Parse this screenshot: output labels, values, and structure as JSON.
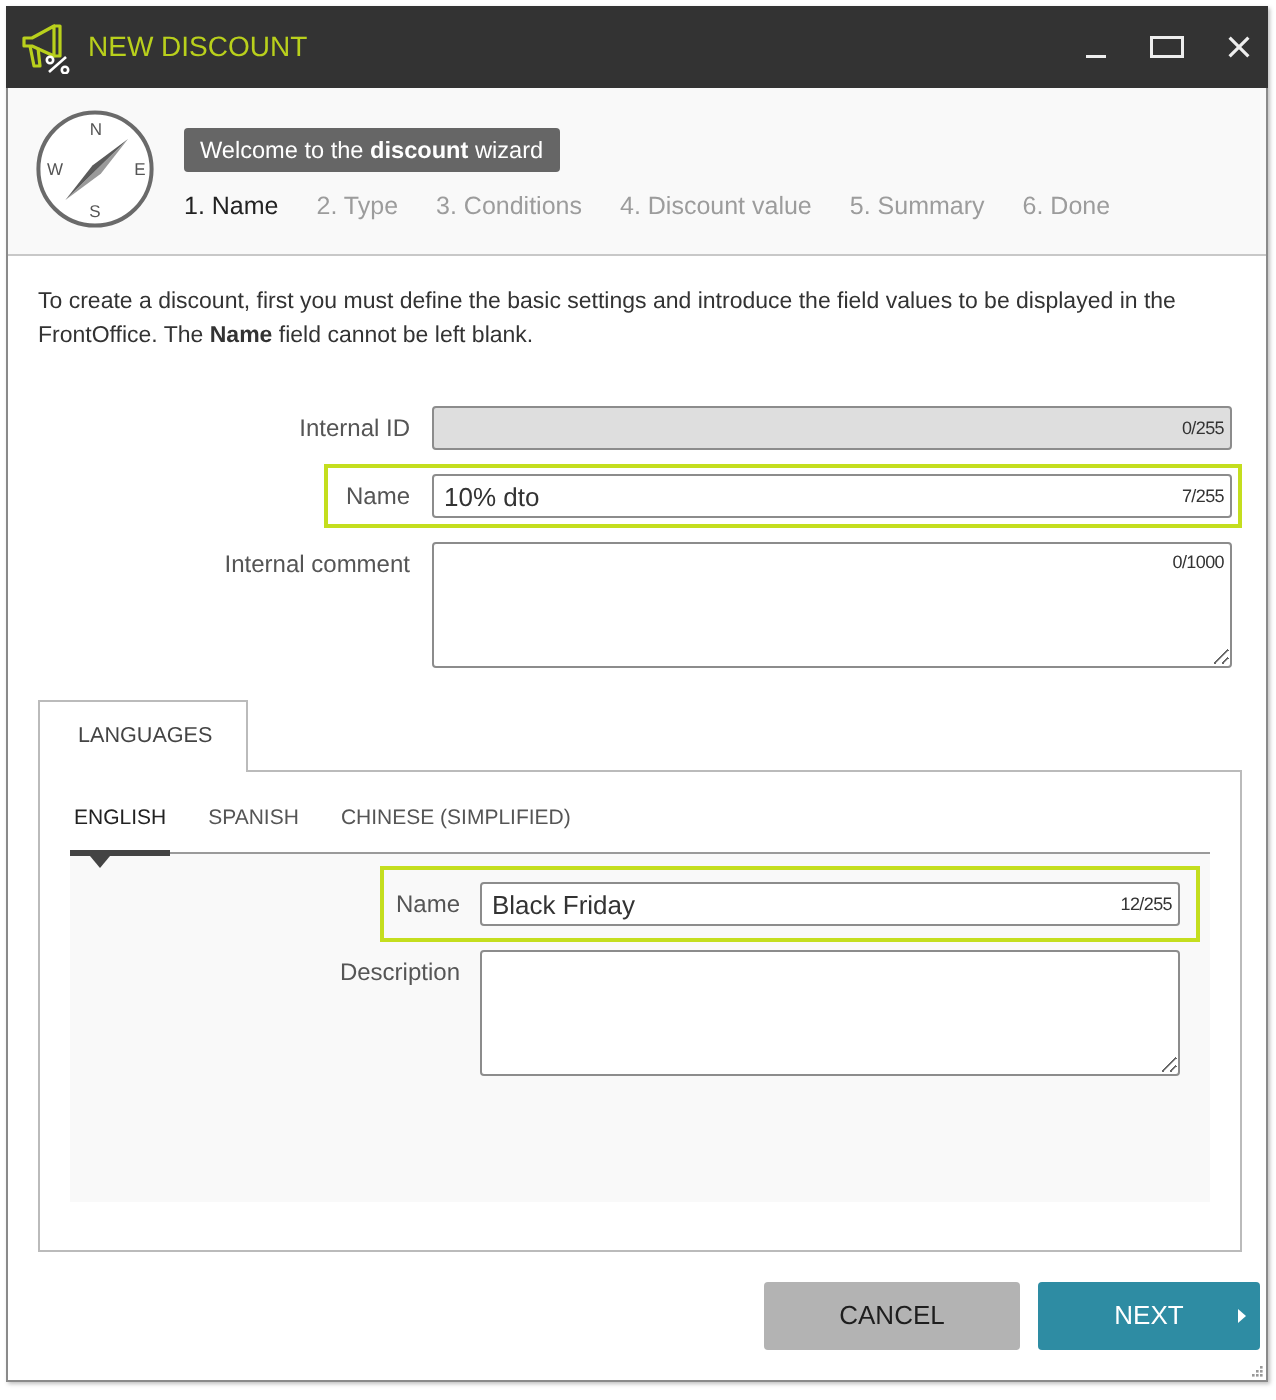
{
  "window": {
    "title": "NEW DISCOUNT"
  },
  "wizard": {
    "compass": {
      "north": "N",
      "west": "W",
      "east": "E",
      "south": "S"
    },
    "welcome": "Welcome to the **discount** wizard",
    "steps": [
      {
        "label": "1. Name",
        "selected": true
      },
      {
        "label": "2. Type",
        "selected": false
      },
      {
        "label": "3. Conditions",
        "selected": false
      },
      {
        "label": "4. Discount value",
        "selected": false
      },
      {
        "label": "5. Summary",
        "selected": false
      },
      {
        "label": "6. Done",
        "selected": false
      }
    ]
  },
  "intro": "To create a discount, first you must define the basic settings and introduce the field values to be displayed in the FrontOffice. The **Name** field cannot be left blank.",
  "fields": [
    {
      "label": "Internal ID",
      "kind": "input",
      "counter": "0/255",
      "disabled": true,
      "highlighted": false
    },
    {
      "label": "Name",
      "kind": "input",
      "value": "10% dto",
      "counter": "7/255",
      "disabled": false,
      "highlighted": true
    },
    {
      "label": "Internal comment",
      "kind": "textarea",
      "counter": "0/1000",
      "disabled": false,
      "highlighted": false
    }
  ],
  "section_tabs": [
    {
      "label": "LANGUAGES",
      "selected": true
    }
  ],
  "language_tabs": [
    {
      "label": "ENGLISH",
      "selected": true
    },
    {
      "label": "SPANISH",
      "selected": false
    },
    {
      "label": "CHINESE (SIMPLIFIED)",
      "selected": false
    }
  ],
  "language_fields": [
    {
      "label": "Name",
      "kind": "input",
      "value": "Black Friday",
      "counter": "12/255",
      "highlighted": true
    },
    {
      "label": "Description",
      "kind": "textarea",
      "highlighted": false
    }
  ],
  "buttons": [
    {
      "label": "CANCEL",
      "kind": "secondary"
    },
    {
      "label": "NEXT",
      "kind": "primary"
    }
  ]
}
